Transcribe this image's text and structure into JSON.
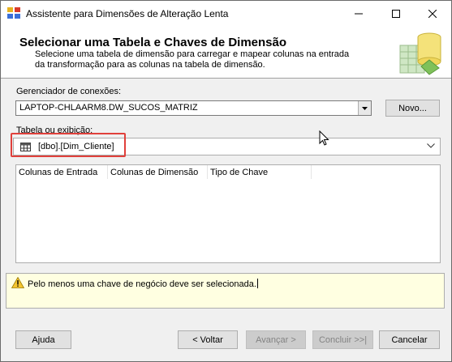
{
  "window": {
    "title": "Assistente para Dimensões de Alteração Lenta"
  },
  "header": {
    "title": "Selecionar uma Tabela e Chaves de Dimensão",
    "description": "Selecione uma tabela de dimensão para carregar e mapear colunas na entrada da transformação para as colunas na tabela de dimensão."
  },
  "connection": {
    "label": "Gerenciador de conexões:",
    "value": "LAPTOP-CHLAARM8.DW_SUCOS_MATRIZ",
    "new_button": "Novo..."
  },
  "table": {
    "label": "Tabela ou exibição:",
    "value": "[dbo].[Dim_Cliente]"
  },
  "grid": {
    "columns": [
      "Colunas de Entrada",
      "Colunas de Dimensão",
      "Tipo de Chave"
    ],
    "rows": []
  },
  "message": {
    "text": "Pelo menos uma chave de negócio deve ser selecionada."
  },
  "buttons": {
    "help": "Ajuda",
    "back": "< Voltar",
    "next": "Avançar >",
    "finish": "Concluir >>|",
    "cancel": "Cancelar"
  },
  "icons": {
    "app": "ssis-component-icon",
    "table": "table-icon",
    "warning": "warning-icon",
    "header_graphic": "dimension-table-graphic"
  },
  "colors": {
    "highlight": "#e0403b",
    "message_background": "#ffffe1"
  }
}
